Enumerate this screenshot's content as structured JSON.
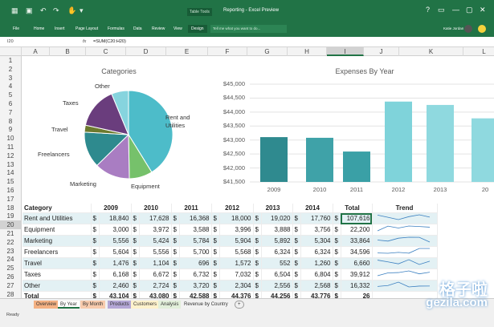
{
  "ribbon": {
    "qat": [
      "File",
      "Home",
      "Insert",
      "Page Layout",
      "Formulas",
      "Data",
      "Review",
      "View",
      "Design"
    ],
    "context_label": "Table Tools",
    "title": "Reporting - Excel Preview",
    "tell_me_placeholder": "Tell me what you want to do...",
    "user": "Katie Jordan",
    "winbtns": [
      "?",
      "▭",
      "—",
      "▢",
      "✕"
    ]
  },
  "formula_bar": {
    "name_box": "I20",
    "fx": "fx",
    "formula": "=SUM(C20:H20)"
  },
  "columns": [
    "A",
    "B",
    "C",
    "D",
    "E",
    "F",
    "G",
    "H",
    "I",
    "J",
    "K",
    "L"
  ],
  "selected_column": "I",
  "rows": [
    "1",
    "2",
    "3",
    "4",
    "5",
    "6",
    "7",
    "8",
    "9",
    "10",
    "11",
    "12",
    "13",
    "14",
    "15",
    "16",
    "17",
    "18",
    "19",
    "20",
    "21",
    "22",
    "23",
    "24",
    "25",
    "26",
    "27",
    "28"
  ],
  "selected_row": "20",
  "pie": {
    "title": "Categories",
    "labels": [
      "Other",
      "Taxes",
      "Travel",
      "Freelancers",
      "Marketing",
      "Equipment",
      "Rent and Utilities"
    ]
  },
  "barchart": {
    "title": "Expenses By Year",
    "ylabels": [
      "$45,000",
      "$44,500",
      "$44,000",
      "$43,500",
      "$43,000",
      "$42,500",
      "$42,000",
      "$41,500"
    ],
    "xlabels": [
      "2009",
      "2010",
      "2011",
      "2012",
      "2013",
      "20"
    ]
  },
  "chart_data": [
    {
      "type": "pie",
      "title": "Categories",
      "categories": [
        "Rent and Utilities",
        "Equipment",
        "Marketing",
        "Freelancers",
        "Travel",
        "Taxes",
        "Other"
      ],
      "values": [
        107616,
        22200,
        33864,
        34596,
        6660,
        39912,
        16332
      ],
      "colors": [
        "#4dbcc9",
        "#76c16b",
        "#a97dc2",
        "#2e8a8e",
        "#6d7a2e",
        "#6a3d7d",
        "#86d4de"
      ]
    },
    {
      "type": "bar",
      "title": "Expenses By Year",
      "categories": [
        "2009",
        "2010",
        "2011",
        "2012",
        "2013",
        "20"
      ],
      "values": [
        43104,
        43080,
        42588,
        44376,
        44256,
        43776
      ],
      "ylim": [
        41500,
        45000
      ],
      "colors": [
        "#2f8a8f",
        "#3fa2a8",
        "#3aa0a6",
        "#7fd3da",
        "#8fd9df",
        "#8fd9df"
      ]
    }
  ],
  "table": {
    "headers": [
      "Category",
      "2009",
      "2010",
      "2011",
      "2012",
      "2013",
      "2014",
      "Total",
      "Trend"
    ],
    "rows": [
      [
        "Rent and Utilities",
        "18,840",
        "17,628",
        "16,368",
        "18,000",
        "19,020",
        "17,760",
        "107,616"
      ],
      [
        "Equipment",
        "3,000",
        "3,972",
        "3,588",
        "3,996",
        "3,888",
        "3,756",
        "22,200"
      ],
      [
        "Marketing",
        "5,556",
        "5,424",
        "5,784",
        "5,904",
        "5,892",
        "5,304",
        "33,864"
      ],
      [
        "Freelancers",
        "5,604",
        "5,556",
        "5,700",
        "5,568",
        "6,324",
        "6,324",
        "34,596"
      ],
      [
        "Travel",
        "1,476",
        "1,104",
        "696",
        "1,572",
        "552",
        "1,260",
        "6,660"
      ],
      [
        "Taxes",
        "6,168",
        "6,672",
        "6,732",
        "7,032",
        "6,504",
        "6,804",
        "39,912"
      ],
      [
        "Other",
        "2,460",
        "2,724",
        "3,720",
        "2,304",
        "2,556",
        "2,568",
        "16,332"
      ],
      [
        "Total",
        "43,104",
        "43,080",
        "42,588",
        "44,376",
        "44,256",
        "43,776",
        "26"
      ]
    ],
    "currency": "$"
  },
  "sheet_tabs": [
    "Overview",
    "By Year",
    "By Month",
    "Products",
    "Customers",
    "Analysis",
    "Revenue by Country"
  ],
  "add_sheet": "+",
  "status": "Ready",
  "watermark": {
    "line1": "格子啦",
    "line2": "gezila.com"
  }
}
